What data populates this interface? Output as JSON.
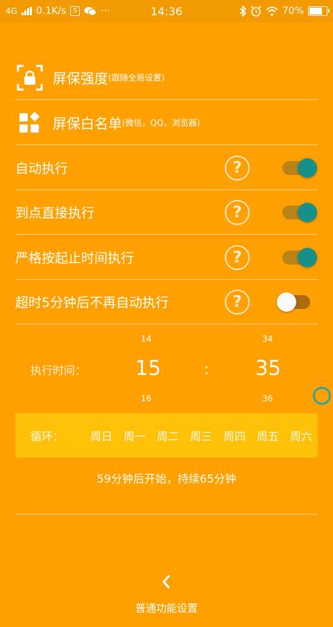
{
  "status_bar": {
    "network": "4G",
    "speed": "0.1K/s",
    "sq_icon_text": "S",
    "more": "···",
    "time": "14:36",
    "battery_percent": "70%",
    "battery_level": 0.7
  },
  "menu": {
    "screen_strength": {
      "title": "屏保强度",
      "sub": "(跟随全局设置)",
      "icon": "lock-icon"
    },
    "whitelist": {
      "title": "屏保白名单",
      "sub": "(微信，QQ，浏览器)",
      "icon": "apps-icon"
    }
  },
  "toggles": [
    {
      "label": "自动执行",
      "on": true
    },
    {
      "label": "到点直接执行",
      "on": true
    },
    {
      "label": "严格按起止时间执行",
      "on": true
    },
    {
      "label": "超时5分钟后不再自动执行",
      "on": false
    }
  ],
  "help_glyph": "?",
  "time_picker": {
    "label": "执行时间：",
    "hour_prev": "14",
    "hour": "15",
    "hour_next": "16",
    "minute_prev": "34",
    "minute": "35",
    "minute_next": "36",
    "separator": ":"
  },
  "cycle": {
    "label": "循环：",
    "days": [
      "周日",
      "周一",
      "周二",
      "周三",
      "周四",
      "周五",
      "周六"
    ]
  },
  "summary": "59分钟后开始，持续65分钟",
  "bottom": {
    "label": "普通功能设置"
  },
  "colors": {
    "background": "#FFA000",
    "cycle_bar": "#FFC107",
    "toggle_knob_on": "#17908A"
  }
}
